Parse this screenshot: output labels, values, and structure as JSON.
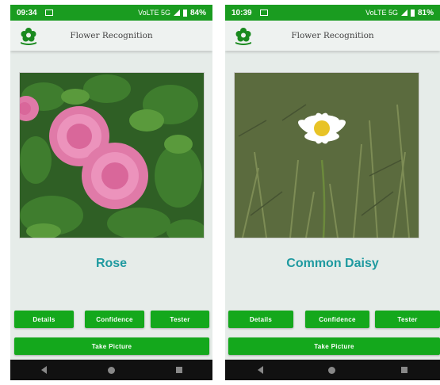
{
  "app_title": "Flower Recognition",
  "buttons": {
    "details": "Details",
    "confidence": "Confidence",
    "tester": "Tester",
    "take_picture": "Take Picture"
  },
  "screens": [
    {
      "status": {
        "time": "09:34",
        "network": "VoLTE 5G",
        "battery": "84%"
      },
      "result": "Rose"
    },
    {
      "status": {
        "time": "10:39",
        "network": "VoLTE 5G",
        "battery": "81%"
      },
      "result": "Common Daisy"
    }
  ],
  "icons": {
    "app_logo": "flower-logo-icon",
    "notification": "notification-icon",
    "signal": "signal-icon",
    "battery": "battery-icon",
    "back": "back-icon",
    "home": "home-icon",
    "recents": "recents-icon"
  },
  "colors": {
    "status_bar": "#1a9c20",
    "button": "#14a81c",
    "result_text": "#1f9aa0"
  }
}
